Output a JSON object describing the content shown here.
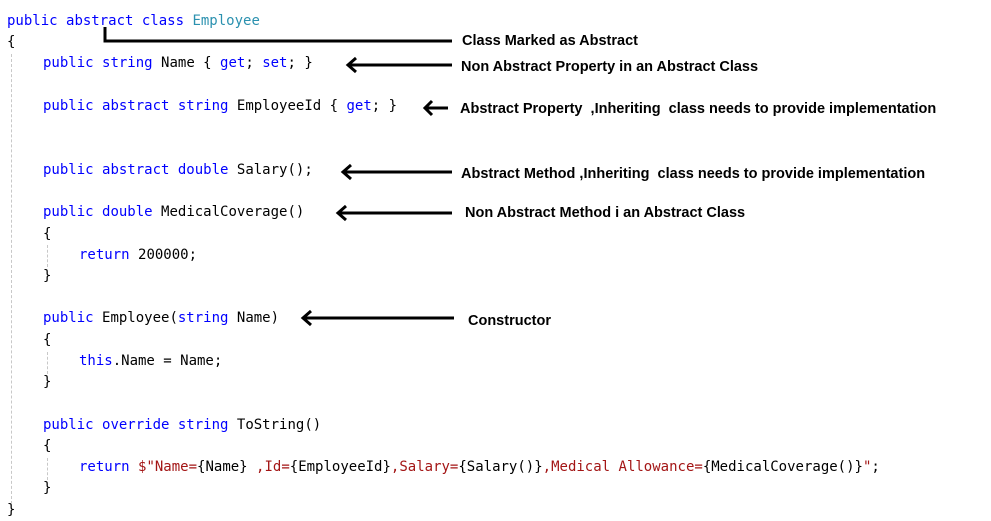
{
  "code_lines": [
    {
      "indent": 0,
      "tokens": [
        {
          "t": "public ",
          "c": "kw"
        },
        {
          "t": "abstract ",
          "c": "kw"
        },
        {
          "t": "class ",
          "c": "kw"
        },
        {
          "t": "Employee",
          "c": "type"
        }
      ]
    },
    {
      "indent": 0,
      "tokens": [
        {
          "t": "{",
          "c": ""
        }
      ]
    },
    {
      "indent": 1,
      "tokens": [
        {
          "t": "public ",
          "c": "kw"
        },
        {
          "t": "string ",
          "c": "kw"
        },
        {
          "t": "Name { ",
          "c": ""
        },
        {
          "t": "get",
          "c": "kw"
        },
        {
          "t": "; ",
          "c": ""
        },
        {
          "t": "set",
          "c": "kw"
        },
        {
          "t": "; }",
          "c": ""
        }
      ]
    },
    {
      "indent": 1,
      "tokens": [
        {
          "t": "public ",
          "c": "kw"
        },
        {
          "t": "abstract ",
          "c": "kw"
        },
        {
          "t": "string ",
          "c": "kw"
        },
        {
          "t": "EmployeeId { ",
          "c": ""
        },
        {
          "t": "get",
          "c": "kw"
        },
        {
          "t": "; }",
          "c": ""
        }
      ]
    },
    {
      "indent": 1,
      "tokens": [
        {
          "t": "public ",
          "c": "kw"
        },
        {
          "t": "abstract ",
          "c": "kw"
        },
        {
          "t": "double ",
          "c": "kw"
        },
        {
          "t": "Salary();",
          "c": ""
        }
      ]
    },
    {
      "indent": 1,
      "tokens": [
        {
          "t": "public ",
          "c": "kw"
        },
        {
          "t": "double ",
          "c": "kw"
        },
        {
          "t": "MedicalCoverage()",
          "c": ""
        }
      ]
    },
    {
      "indent": 1,
      "tokens": [
        {
          "t": "{",
          "c": ""
        }
      ]
    },
    {
      "indent": 2,
      "tokens": [
        {
          "t": "return ",
          "c": "kw"
        },
        {
          "t": "200000;",
          "c": ""
        }
      ]
    },
    {
      "indent": 1,
      "tokens": [
        {
          "t": "}",
          "c": ""
        }
      ]
    },
    {
      "indent": 1,
      "tokens": [
        {
          "t": "public ",
          "c": "kw"
        },
        {
          "t": "Employee(",
          "c": ""
        },
        {
          "t": "string ",
          "c": "kw"
        },
        {
          "t": "Name)",
          "c": ""
        }
      ]
    },
    {
      "indent": 1,
      "tokens": [
        {
          "t": "{",
          "c": ""
        }
      ]
    },
    {
      "indent": 2,
      "tokens": [
        {
          "t": "this",
          "c": "kw"
        },
        {
          "t": ".Name = Name;",
          "c": ""
        }
      ]
    },
    {
      "indent": 1,
      "tokens": [
        {
          "t": "}",
          "c": ""
        }
      ]
    },
    {
      "indent": 1,
      "tokens": [
        {
          "t": "public ",
          "c": "kw"
        },
        {
          "t": "override ",
          "c": "kw"
        },
        {
          "t": "string ",
          "c": "kw"
        },
        {
          "t": "ToString()",
          "c": ""
        }
      ]
    },
    {
      "indent": 1,
      "tokens": [
        {
          "t": "{",
          "c": ""
        }
      ]
    },
    {
      "indent": 2,
      "tokens": [
        {
          "t": "return ",
          "c": "kw"
        },
        {
          "t": "$\"Name=",
          "c": "str"
        },
        {
          "t": "{Name}",
          "c": ""
        },
        {
          "t": " ,Id=",
          "c": "str"
        },
        {
          "t": "{EmployeeId}",
          "c": ""
        },
        {
          "t": ",Salary=",
          "c": "str"
        },
        {
          "t": "{Salary()}",
          "c": ""
        },
        {
          "t": ",Medical Allowance=",
          "c": "str"
        },
        {
          "t": "{MedicalCoverage()}",
          "c": ""
        },
        {
          "t": "\"",
          "c": "str"
        },
        {
          "t": ";",
          "c": ""
        }
      ]
    },
    {
      "indent": 1,
      "tokens": [
        {
          "t": "}",
          "c": ""
        }
      ]
    },
    {
      "indent": 0,
      "tokens": [
        {
          "t": "}",
          "c": ""
        }
      ]
    }
  ],
  "annotations": [
    {
      "id": "class-marked-abstract",
      "text": "Class Marked as Abstract"
    },
    {
      "id": "non-abstract-property",
      "text": "Non Abstract Property in an Abstract Class"
    },
    {
      "id": "abstract-property",
      "text": "Abstract Property  ,Inheriting  class needs to provide implementation"
    },
    {
      "id": "abstract-method",
      "text": "Abstract Method ,Inheriting  class needs to provide implementation"
    },
    {
      "id": "non-abstract-method",
      "text": "Non Abstract Method i an Abstract Class"
    },
    {
      "id": "constructor",
      "text": "Constructor"
    }
  ]
}
